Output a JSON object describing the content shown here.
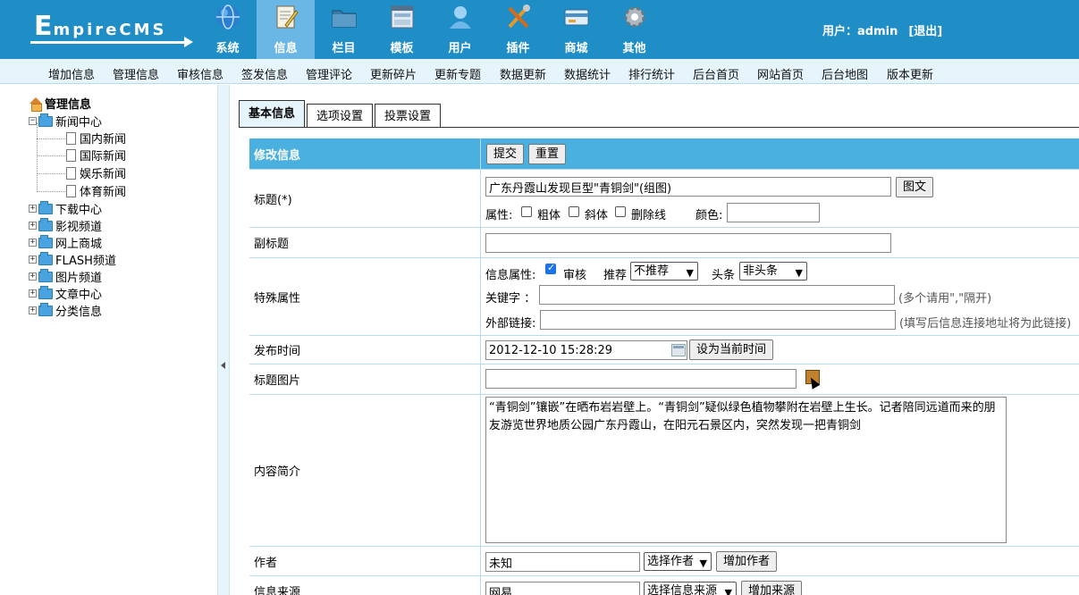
{
  "header": {
    "logo_main": "E",
    "logo_rest": "mpireCMS",
    "nav": [
      {
        "label": "系统",
        "icon": "globe-icon",
        "color": "#2b7fd0"
      },
      {
        "label": "信息",
        "icon": "edit-note-icon",
        "color": "#e8c45a",
        "active": true
      },
      {
        "label": "栏目",
        "icon": "folder-icon",
        "color": "#3a7ca8"
      },
      {
        "label": "模板",
        "icon": "window-template-icon",
        "color": "#8fb3d0"
      },
      {
        "label": "用户",
        "icon": "user-icon",
        "color": "#6fb7e8"
      },
      {
        "label": "插件",
        "icon": "tools-icon",
        "color": "#e09a2a"
      },
      {
        "label": "商城",
        "icon": "credit-card-icon",
        "color": "#4b8fc7"
      },
      {
        "label": "其他",
        "icon": "gear-icon",
        "color": "#b0b7bf"
      }
    ],
    "user_label": "用户：admin",
    "logout": "[退出]"
  },
  "subnav": [
    "增加信息",
    "管理信息",
    "审核信息",
    "签发信息",
    "管理评论",
    "更新碎片",
    "更新专题",
    "数据更新",
    "数据统计",
    "排行统计",
    "后台首页",
    "网站首页",
    "后台地图",
    "版本更新"
  ],
  "tree": {
    "root": "管理信息",
    "news_center": "新闻中心",
    "news_children": [
      "国内新闻",
      "国际新闻",
      "娱乐新闻",
      "体育新闻"
    ],
    "others": [
      "下载中心",
      "影视频道",
      "网上商城",
      "FLASH频道",
      "图片频道",
      "文章中心",
      "分类信息"
    ]
  },
  "tabs": [
    "基本信息",
    "选项设置",
    "投票设置"
  ],
  "form": {
    "head_label": "修改信息",
    "submit": "提交",
    "reset": "重置",
    "title_label": "标题(*)",
    "title_value": "广东丹霞山发现巨型\"青铜剑\"(组图)",
    "title_pic_button": "图文",
    "attr_label": "属性:",
    "bold": "粗体",
    "italic": "斜体",
    "strike": "删除线",
    "color_label": "颜色:",
    "subtitle_label": "副标题",
    "special_label": "特殊属性",
    "info_attr_label": "信息属性:",
    "audit": "审核",
    "recommend_label": "推荐",
    "recommend_value": "不推荐",
    "headline_label": "头条",
    "headline_value": "非头条",
    "keyword_label": "关键字  ：",
    "keyword_hint": "(多个请用\",\"隔开)",
    "link_label": "外部链接:",
    "link_hint": "(填写后信息连接地址将为此链接)",
    "time_label": "发布时间",
    "time_value": "2012-12-10 15:28:29",
    "time_button": "设为当前时间",
    "pic_label": "标题图片",
    "summary_label": "内容简介",
    "summary_value": "“青铜剑”镶嵌”在晒布岩岩壁上。“青铜剑”疑似绿色植物攀附在岩壁上生长。记者陪同远道而来的朋友游览世界地质公园广东丹霞山，在阳元石景区内，突然发现一把青铜剑",
    "author_label": "作者",
    "author_value": "未知",
    "author_select": "选择作者",
    "author_button": "增加作者",
    "source_label": "信息来源",
    "source_value": "网易",
    "source_select": "选择信息来源",
    "source_button": "增加来源"
  }
}
